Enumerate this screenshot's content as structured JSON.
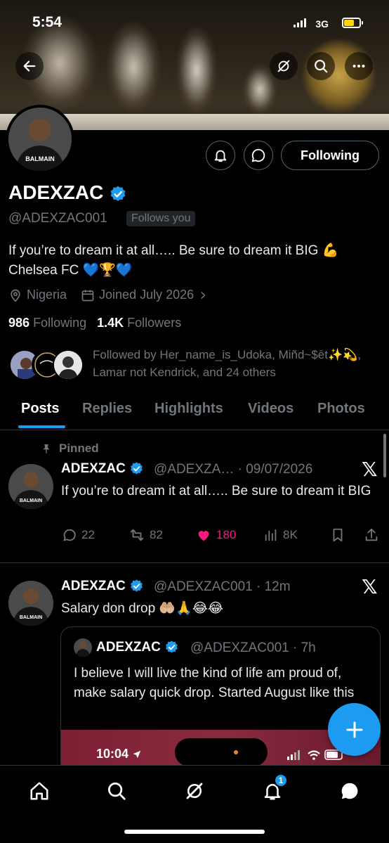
{
  "status_bar": {
    "time": "5:54",
    "network": "3G"
  },
  "profile": {
    "name": "ADEXZAC",
    "handle": "@ADEXZAC001",
    "follows_you": "Follows you",
    "bio_line1": "If you’re to dream it at all….. Be sure to dream it BIG 💪",
    "bio_line2": "Chelsea FC 💙🏆💙",
    "location": "Nigeria",
    "joined": "Joined July 2026",
    "following_count": "986",
    "following_label": "Following",
    "followers_count": "1.4K",
    "followers_label": "Followers",
    "followed_by": "Followed by Her_name_is_Udoka, Miñd~$ēt✨💫, Lamar not Kendrick, and 24 others",
    "following_button": "Following",
    "avatar_text": "BALMAIN"
  },
  "tabs": [
    "Posts",
    "Replies",
    "Highlights",
    "Videos",
    "Photos"
  ],
  "pinned_label": "Pinned",
  "tweets": [
    {
      "name": "ADEXZAC",
      "handle_date": "@ADEXZA… · 09/07/2026",
      "text": "If you’re to dream it at all….. Be sure to dream it BIG",
      "replies": "22",
      "retweets": "82",
      "likes": "180",
      "views": "8K"
    },
    {
      "name": "ADEXZAC",
      "handle_date": "@ADEXZAC001 · 12m",
      "text": "Salary don drop 🤲🏼🙏😂😂",
      "quote": {
        "name": "ADEXZAC",
        "handle_date": "@ADEXZAC001 · 7h",
        "text": "I believe I will live the kind of life am proud of, make salary quick drop. Started August like this",
        "image_time": "10:04"
      }
    }
  ],
  "notification_badge": "1",
  "colors": {
    "accent": "#1d9bf0",
    "like": "#f91880",
    "muted": "#71767b",
    "background": "#000000"
  }
}
